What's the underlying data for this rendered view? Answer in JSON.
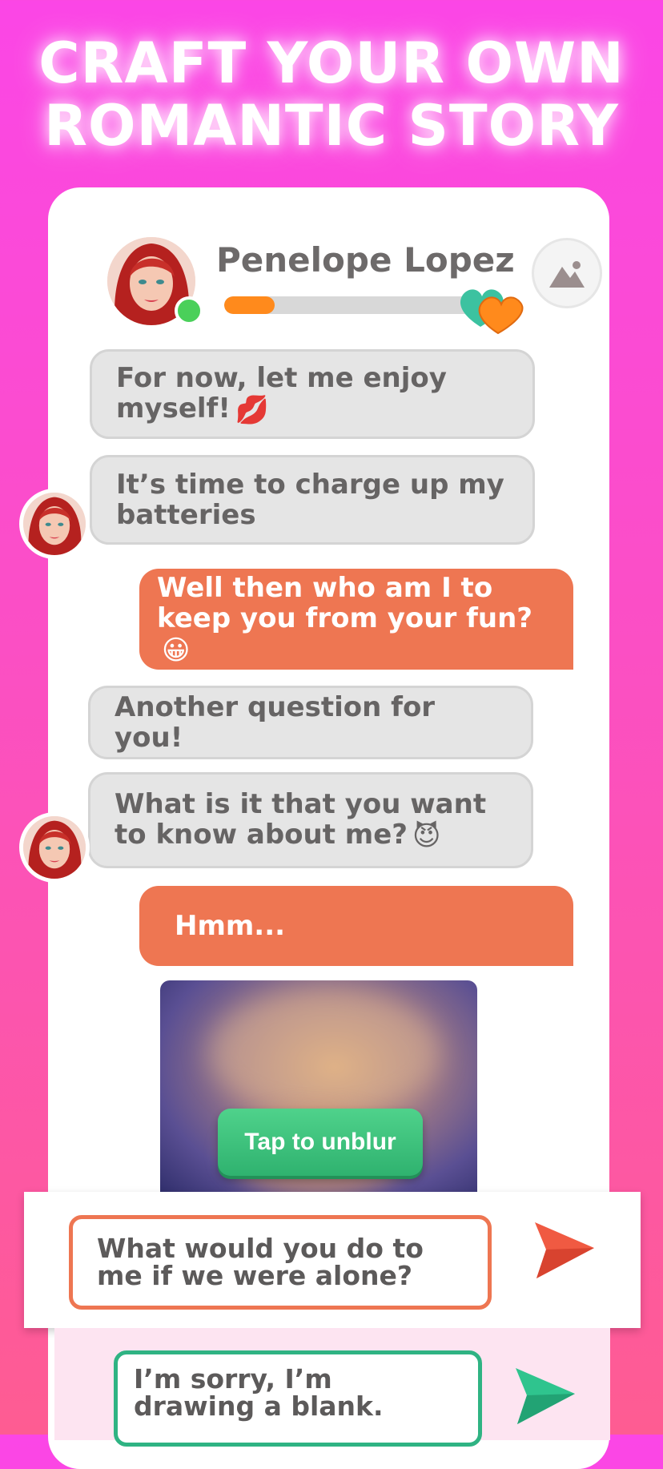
{
  "headline": {
    "line1": "CRAFT YOUR OWN",
    "line2": "ROMANTIC STORY"
  },
  "chat": {
    "contact_name": "Penelope Lopez",
    "status": "online",
    "relationship_level": 0.19,
    "gallery_icon": "image-icon",
    "hearts_icon": "hearts-icon"
  },
  "messages": [
    {
      "from": "them",
      "text": "For now, let me enjoy myself!",
      "emoji": "💋"
    },
    {
      "from": "them",
      "text": "It’s time to charge up my batteries",
      "emoji": ""
    },
    {
      "from": "me",
      "text": "Well then who am I to keep you from your fun?",
      "emoji": "😀"
    },
    {
      "from": "them",
      "text": "Another question for you!",
      "emoji": ""
    },
    {
      "from": "them",
      "text": "What is it that you want to know about me?",
      "emoji": "😈"
    },
    {
      "from": "me",
      "text": "Hmm...",
      "emoji": ""
    }
  ],
  "photo": {
    "unblur_label": "Tap to unblur"
  },
  "replies": [
    {
      "text": "What would you do to me if we were alone?",
      "send_icon": "send-arrow-icon",
      "color": "#ee7652"
    },
    {
      "text": "I’m sorry, I’m drawing a blank.",
      "send_icon": "send-arrow-icon",
      "color": "#2fb383"
    }
  ],
  "colors": {
    "background_top": "#fb46e6",
    "background_bottom": "#fe5c92",
    "outgoing_bubble": "#ee7652",
    "incoming_bubble": "#e5e5e5",
    "love_bar_fill": "#ff8a1c",
    "unblur_button": "#3cc27b"
  }
}
